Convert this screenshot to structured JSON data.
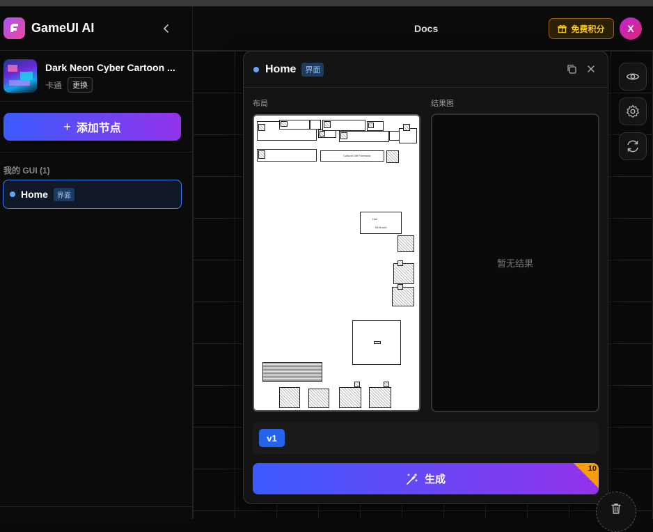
{
  "app": {
    "name": "GameUI AI"
  },
  "style": {
    "title": "Dark Neon Cyber Cartoon ...",
    "category": "卡通",
    "change_label": "更换"
  },
  "sidebar": {
    "add_node_label": "添加节点",
    "gui_heading": "我的 GUI (1)",
    "items": [
      {
        "label": "Home",
        "tag": "界面"
      }
    ]
  },
  "header": {
    "docs_label": "Docs",
    "free_points_label": "免费积分",
    "avatar_letter": "X"
  },
  "panel": {
    "title": "Home",
    "tag": "界面",
    "layout_label": "布局",
    "result_label": "结果图",
    "empty_result": "暂无结果",
    "version": "v1",
    "generate_label": "生成",
    "cost": "10",
    "wireframe_text": {
      "title_box": "Cultural Gift Farmland",
      "popup_a": "Hall",
      "popup_b": "Bit Board"
    }
  },
  "colors": {
    "accent_blue": "#3b82f6",
    "gradient_start": "#3b5bff",
    "gradient_end": "#9333ea",
    "points_gold": "#facc15",
    "cost_badge": "#f59e0b"
  },
  "icons": [
    "app-logo-icon",
    "chevron-left-icon",
    "plus-icon",
    "gift-icon",
    "eye-icon",
    "gear-icon",
    "refresh-icon",
    "copy-icon",
    "close-icon",
    "magic-wand-icon",
    "trash-icon"
  ]
}
